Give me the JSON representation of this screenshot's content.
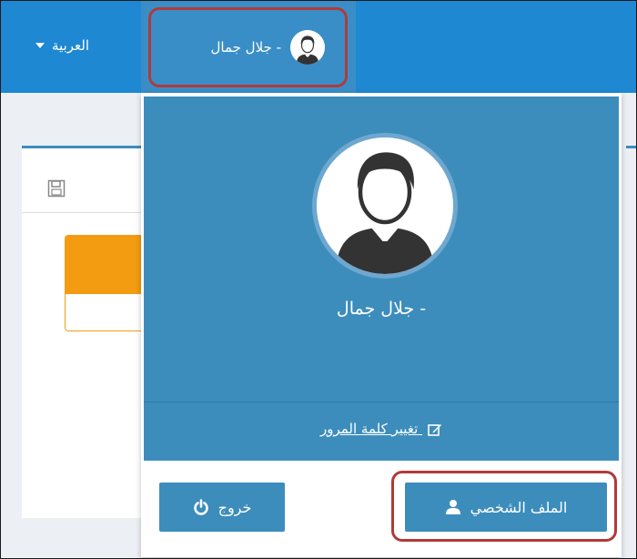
{
  "topbar": {
    "language_label": "العربية",
    "user_label": "جلال جمال -"
  },
  "dropdown": {
    "user_name": "جلال جمال -",
    "change_password_label": "تغيير كلمة المرور",
    "profile_button_label": "الملف الشخصي",
    "logout_button_label": "خروج"
  },
  "colors": {
    "topbar": "#1e88d2",
    "panel": "#3c8dbc",
    "highlight": "#b03a3a",
    "orange": "#f39c12"
  },
  "icons": [
    "caret-down-icon",
    "user-avatar-icon",
    "save-icon",
    "edit-icon",
    "user-icon",
    "power-icon"
  ]
}
